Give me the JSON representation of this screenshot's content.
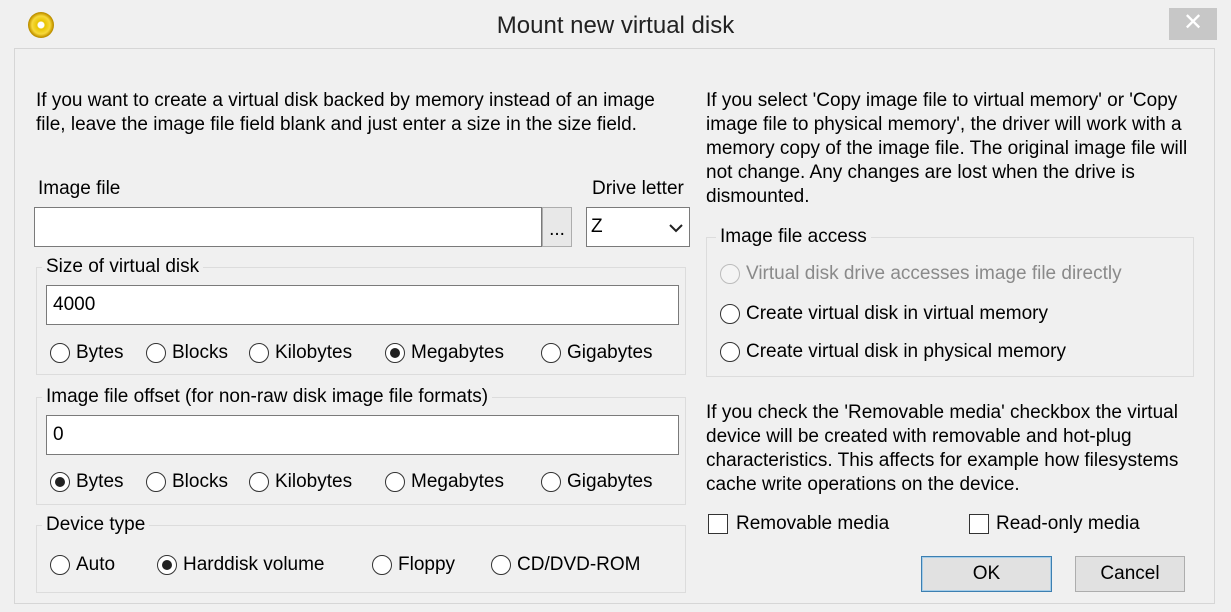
{
  "window": {
    "title": "Mount new virtual disk",
    "close_glyph": "✕"
  },
  "left": {
    "intro": "If you want to create a virtual disk backed by memory instead of an image file, leave the image file field blank and just enter a size in the size field.",
    "image_file_label": "Image file",
    "image_file_value": "",
    "browse_label": "...",
    "drive_letter_label": "Drive letter",
    "drive_letter_value": "Z",
    "size_group": {
      "legend": "Size of virtual disk",
      "value": "4000",
      "units": [
        "Bytes",
        "Blocks",
        "Kilobytes",
        "Megabytes",
        "Gigabytes"
      ],
      "selected": "Megabytes"
    },
    "offset_group": {
      "legend": "Image file offset (for non-raw disk image file formats)",
      "value": "0",
      "units": [
        "Bytes",
        "Blocks",
        "Kilobytes",
        "Megabytes",
        "Gigabytes"
      ],
      "selected": "Bytes"
    },
    "device_group": {
      "legend": "Device type",
      "options": [
        "Auto",
        "Harddisk volume",
        "Floppy",
        "CD/DVD-ROM"
      ],
      "selected": "Harddisk volume"
    }
  },
  "right": {
    "copy_info": "If you select 'Copy image file to virtual memory' or 'Copy image file to physical memory', the driver will work with a memory copy of the image file. The original image file will not change. Any changes are lost when the drive is dismounted.",
    "access_group": {
      "legend": "Image file access",
      "options": [
        "Virtual disk drive accesses image file directly",
        "Create virtual disk in virtual memory",
        "Create virtual disk in physical memory"
      ]
    },
    "removable_info": "If you check the 'Removable media' checkbox the virtual device will be created with removable and hot-plug characteristics. This affects for example how filesystems cache write operations on the device.",
    "removable_label": "Removable media",
    "readonly_label": "Read-only media",
    "ok_label": "OK",
    "cancel_label": "Cancel"
  }
}
